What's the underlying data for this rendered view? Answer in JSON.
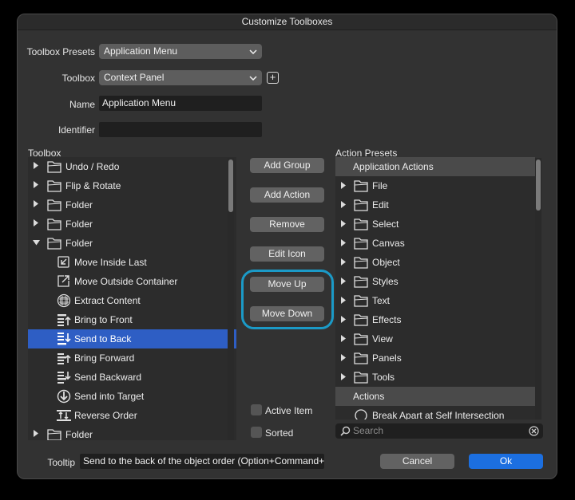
{
  "window": {
    "title": "Customize Toolboxes"
  },
  "form": {
    "presets_label": "Toolbox Presets",
    "presets_value": "Application Menu",
    "toolbox_label": "Toolbox",
    "toolbox_value": "Context Panel",
    "name_label": "Name",
    "name_value": "Application Menu",
    "identifier_label": "Identifier",
    "identifier_value": ""
  },
  "toolbox": {
    "label": "Toolbox",
    "items": [
      {
        "label": "Undo / Redo",
        "icon": "folder-icon",
        "tree": "collapsed"
      },
      {
        "label": "Flip & Rotate",
        "icon": "folder-icon",
        "tree": "collapsed"
      },
      {
        "label": "Folder",
        "icon": "folder-icon",
        "tree": "collapsed"
      },
      {
        "label": "Folder",
        "icon": "folder-icon",
        "tree": "collapsed"
      },
      {
        "label": "Folder",
        "icon": "folder-icon",
        "tree": "expanded"
      },
      {
        "label": "Move Inside Last",
        "icon": "move-inside-icon",
        "tree": "child"
      },
      {
        "label": "Move Outside Container",
        "icon": "move-outside-icon",
        "tree": "child"
      },
      {
        "label": "Extract Content",
        "icon": "extract-content-icon",
        "tree": "child"
      },
      {
        "label": "Bring to Front",
        "icon": "bring-to-front-icon",
        "tree": "child"
      },
      {
        "label": "Send to Back",
        "icon": "send-to-back-icon",
        "tree": "child",
        "selected": true
      },
      {
        "label": "Bring Forward",
        "icon": "bring-forward-icon",
        "tree": "child"
      },
      {
        "label": "Send Backward",
        "icon": "send-backward-icon",
        "tree": "child"
      },
      {
        "label": "Send into Target",
        "icon": "send-into-target-icon",
        "tree": "child"
      },
      {
        "label": "Reverse Order",
        "icon": "reverse-order-icon",
        "tree": "child"
      },
      {
        "label": "Folder",
        "icon": "folder-icon",
        "tree": "collapsed"
      }
    ]
  },
  "buttons": {
    "add_group": "Add Group",
    "add_action": "Add Action",
    "remove": "Remove",
    "edit_icon": "Edit Icon",
    "move_up": "Move Up",
    "move_down": "Move Down"
  },
  "options": {
    "active_item": "Active Item",
    "sorted": "Sorted"
  },
  "presets": {
    "label": "Action Presets",
    "header1": "Application Actions",
    "items": [
      "File",
      "Edit",
      "Select",
      "Canvas",
      "Object",
      "Styles",
      "Text",
      "Effects",
      "View",
      "Panels",
      "Tools"
    ],
    "header2": "Actions",
    "partial_item": "Break Apart at Self Intersection"
  },
  "search": {
    "placeholder": "Search"
  },
  "tooltip": {
    "label": "Tooltip",
    "value": "Send to the back of the object order (Option+Command+B)"
  },
  "footer": {
    "cancel": "Cancel",
    "ok": "Ok"
  }
}
